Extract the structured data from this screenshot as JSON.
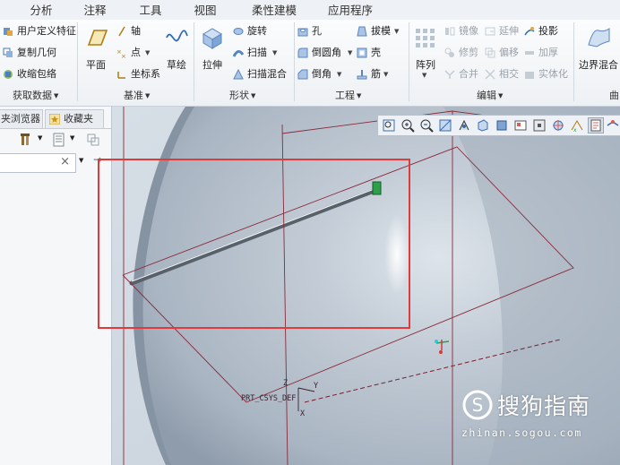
{
  "tabs": [
    "分析",
    "注释",
    "工具",
    "视图",
    "柔性建模",
    "应用程序"
  ],
  "groups": {
    "get_data": {
      "label": "获取数据",
      "items": [
        "用户定义特征",
        "复制几何",
        "收缩包络"
      ]
    },
    "datum": {
      "label": "基准",
      "plane": "平面",
      "axis": "轴",
      "point": "点",
      "csys": "坐标系",
      "sketch": "草绘"
    },
    "shape": {
      "label": "形状",
      "extrude": "拉伸",
      "revolve": "旋转",
      "sweep": "扫描",
      "swept_blend": "扫描混合"
    },
    "engineering": {
      "label": "工程",
      "hole": "孔",
      "round": "倒圆角",
      "chamfer": "倒角",
      "draft": "拔模",
      "shell": "壳",
      "rib": "筋"
    },
    "editing": {
      "label": "编辑",
      "pattern": "阵列",
      "mirror": "镜像",
      "extend": "延伸",
      "project": "投影",
      "trim": "修剪",
      "offset": "偏移",
      "thicken": "加厚",
      "merge": "合并",
      "intersect": "相交",
      "solidify": "实体化"
    },
    "surfaces": {
      "label": "曲",
      "boundary_blend": "边界混合"
    }
  },
  "left_panel": {
    "tab1": "夹浏览器",
    "tab2": "收藏夹",
    "clear_symbol": "×"
  },
  "viewport": {
    "csys_label": "PRT_CSYS_DEF",
    "csys_z": "Z",
    "csys_y": "Y",
    "csys_x": "X"
  },
  "watermark": {
    "text": "搜狗指南",
    "sub": "zhinan.sogou.com"
  },
  "colors": {
    "highlight_box": "#e23a3a",
    "model_surface": "#b5c1ce",
    "datum_lines": "#8a2a3a"
  }
}
